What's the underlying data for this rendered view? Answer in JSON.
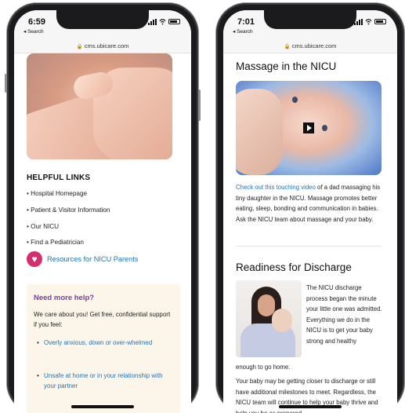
{
  "left_phone": {
    "status": {
      "time": "6:59",
      "back_label": "◂ Search"
    },
    "url": "cms.ubicare.com",
    "helpful_links": {
      "title": "HELPFUL LINKS",
      "items": [
        "Hospital Homepage",
        "Patient & Visitor Information",
        "Our NICU",
        "Find a Pediatrician"
      ]
    },
    "resources_link": "Resources for NICU Parents",
    "help_box": {
      "title": "Need more help?",
      "text": "We care about you! Get free, confidential support if you feel:",
      "bullets": [
        "Overly anxious, down or over-whelmed",
        "Unsafe at home or in your relationship with your partner"
      ]
    }
  },
  "right_phone": {
    "status": {
      "time": "7:01",
      "back_label": "◂ Search"
    },
    "url": "cms.ubicare.com",
    "massage": {
      "title": "Massage in the NICU",
      "link_text": "Check out this touching video",
      "text": " of a dad massaging his tiny daughter in the NICU. Massage promotes better eating, sleep, bonding and communication in babies. Ask the NICU team about massage and your baby."
    },
    "discharge": {
      "title": "Readiness for Discharge",
      "wrap_text": "The NICU discharge process began the minute your little one was admitted. Everything we do in the NICU is to get your baby strong and healthy",
      "continue_text": "enough to go home.",
      "para2": "Your baby may be getting closer to discharge or still have additional milestones to meet. Regardless, the NICU team will continue to help your baby thrive and help you be as prepared"
    }
  },
  "colors": {
    "link": "#1f73b7",
    "help_title": "#7a3c9a",
    "help_bg": "#fcf6ea",
    "resource_icon": "#d62f70"
  }
}
